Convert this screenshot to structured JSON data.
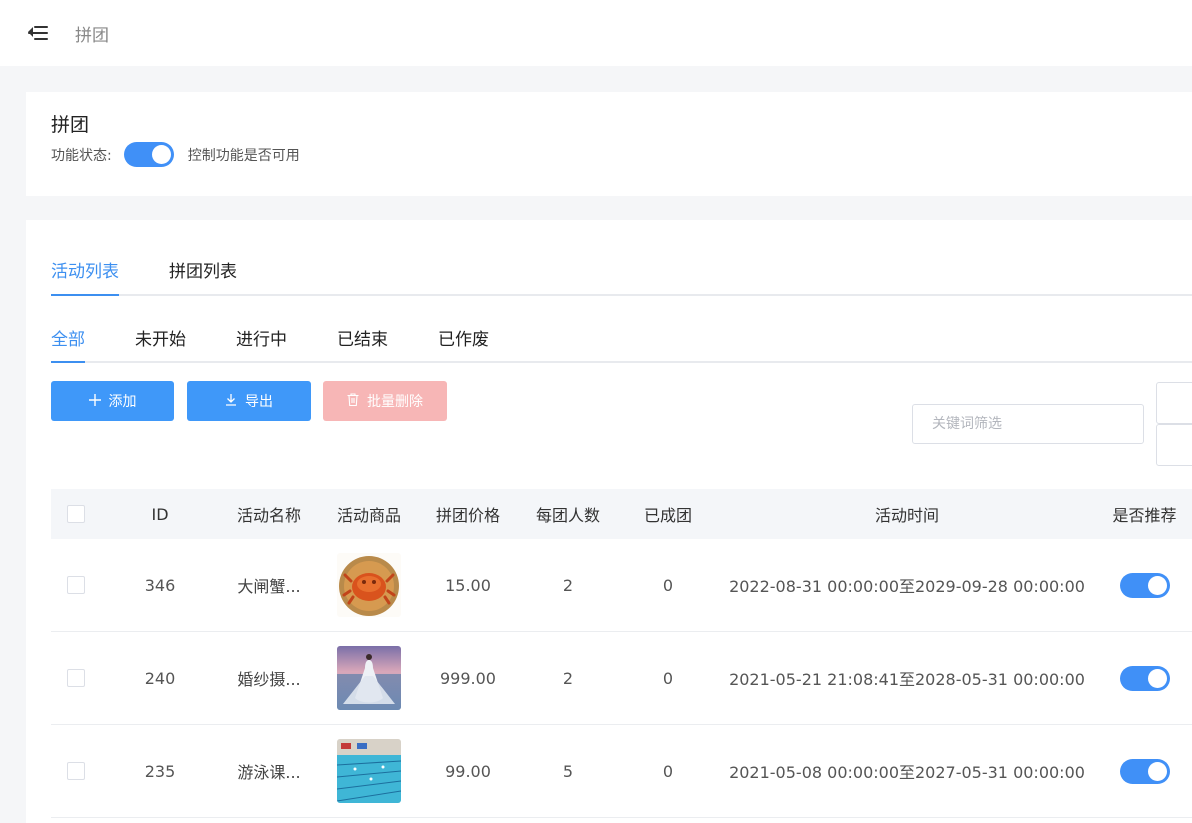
{
  "header": {
    "menu_icon": "menu-fold-icon",
    "breadcrumb": "拼团"
  },
  "settings": {
    "title": "拼团",
    "status_label": "功能状态:",
    "status_on": true,
    "status_tip": "控制功能是否可用"
  },
  "tabs": [
    {
      "label": "活动列表",
      "active": true
    },
    {
      "label": "拼团列表",
      "active": false
    }
  ],
  "subtabs": [
    {
      "label": "全部",
      "active": true
    },
    {
      "label": "未开始",
      "active": false
    },
    {
      "label": "进行中",
      "active": false
    },
    {
      "label": "已结束",
      "active": false
    },
    {
      "label": "已作废",
      "active": false
    }
  ],
  "toolbar": {
    "add_label": "添加",
    "export_label": "导出",
    "batch_delete_label": "批量删除",
    "search_placeholder": "关键词筛选"
  },
  "table": {
    "columns": [
      "ID",
      "活动名称",
      "活动商品",
      "拼团价格",
      "每团人数",
      "已成团",
      "活动时间",
      "是否推荐"
    ],
    "rows": [
      {
        "id": "346",
        "name": "大闸蟹...",
        "image": "crab",
        "price": "15.00",
        "people": "2",
        "done": "0",
        "time": "2022-08-31 00:00:00至2029-09-28 00:00:00",
        "recommend": true
      },
      {
        "id": "240",
        "name": "婚纱摄...",
        "image": "wedding",
        "price": "999.00",
        "people": "2",
        "done": "0",
        "time": "2021-05-21 21:08:41至2028-05-31 00:00:00",
        "recommend": true
      },
      {
        "id": "235",
        "name": "游泳课...",
        "image": "swimming-pool",
        "price": "99.00",
        "people": "5",
        "done": "0",
        "time": "2021-05-08 00:00:00至2027-05-31 00:00:00",
        "recommend": true
      }
    ]
  },
  "colors": {
    "primary": "#3f98f9",
    "danger_disabled": "#f7b6b6",
    "switch_on": "#4090f7"
  }
}
